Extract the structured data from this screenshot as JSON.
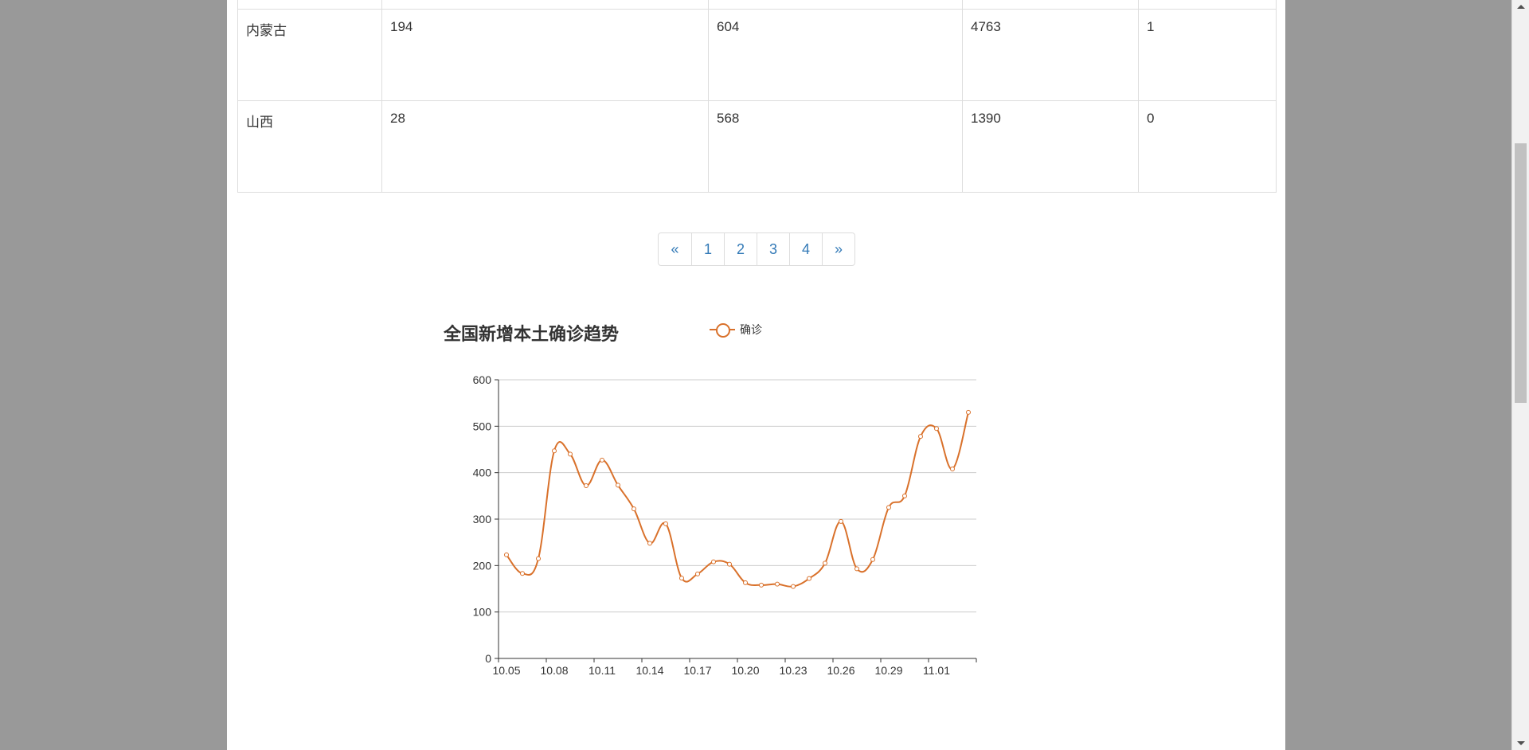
{
  "table": {
    "rows": [
      [
        "内蒙古",
        "194",
        "604",
        "4763",
        "1"
      ],
      [
        "山西",
        "28",
        "568",
        "1390",
        "0"
      ]
    ]
  },
  "pagination": {
    "prev": "«",
    "pages": [
      "1",
      "2",
      "3",
      "4"
    ],
    "next": "»"
  },
  "chart_data": {
    "type": "line",
    "title": "全国新增本土确诊趋势",
    "legend_position": "top",
    "series": [
      {
        "name": "确诊",
        "color": "#d9712b",
        "smooth": true,
        "values": [
          223,
          183,
          215,
          447,
          440,
          372,
          427,
          373,
          322,
          248,
          290,
          173,
          182,
          208,
          203,
          163,
          158,
          160,
          155,
          172,
          205,
          295,
          193,
          213,
          325,
          350,
          478,
          495,
          408,
          530
        ]
      }
    ],
    "x": [
      "10.05",
      "10.06",
      "10.07",
      "10.08",
      "10.09",
      "10.10",
      "10.11",
      "10.12",
      "10.13",
      "10.14",
      "10.15",
      "10.16",
      "10.17",
      "10.18",
      "10.19",
      "10.20",
      "10.21",
      "10.22",
      "10.23",
      "10.24",
      "10.25",
      "10.26",
      "10.27",
      "10.28",
      "10.29",
      "10.30",
      "10.31",
      "11.01",
      "11.02",
      "11.03"
    ],
    "x_tick_labels": [
      "10.05",
      "10.08",
      "10.11",
      "10.14",
      "10.17",
      "10.20",
      "10.23",
      "10.26",
      "10.29",
      "11.01"
    ],
    "y_ticks": [
      "0",
      "100",
      "200",
      "300",
      "400",
      "500",
      "600"
    ],
    "ylim": [
      0,
      600
    ],
    "grid": true
  }
}
